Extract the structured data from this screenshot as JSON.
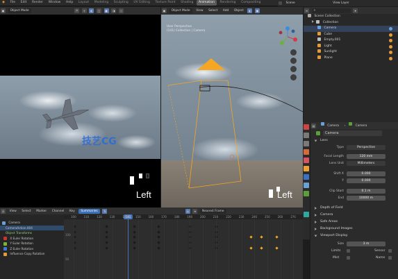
{
  "menu": {
    "items": [
      "File",
      "Edit",
      "Render",
      "Window",
      "Help"
    ],
    "workspaces": [
      "Layout",
      "Modeling",
      "Sculpting",
      "UV Editing",
      "Texture Paint",
      "Shading",
      "Animation",
      "Rendering",
      "Compositing"
    ],
    "active_workspace": "Animation",
    "scene": "Scene",
    "view_layer": "View Layer"
  },
  "viewport_header": {
    "left_mode": "Object Mode",
    "orientation": "Global",
    "default": "Default",
    "drag": "Drag",
    "select_box": "Select Box",
    "local": "Local",
    "viewport_menus": [
      "View",
      "Select",
      "Add",
      "Object"
    ],
    "object_mode_right": "Object Mode",
    "cursor": "Cursor",
    "options": "Options"
  },
  "camera_view": {
    "label_line1": "User Perspective",
    "label_line2": "(141) Collection | Camera",
    "left_text_a": "Left",
    "left_text_b": "Left",
    "watermark": "技艺CG"
  },
  "outliner": {
    "title": "Scene Collection",
    "rows": [
      {
        "name": "Collection",
        "indent": 0,
        "color": "#bdbdbd",
        "selected": false
      },
      {
        "name": "Camera",
        "indent": 1,
        "color": "#6aa0d8",
        "selected": true
      },
      {
        "name": "Cube",
        "indent": 1,
        "color": "#e59a3a",
        "selected": false
      },
      {
        "name": "Empty.001",
        "indent": 1,
        "color": "#bdbdbd",
        "selected": false
      },
      {
        "name": "Light",
        "indent": 1,
        "color": "#e59a3a",
        "selected": false
      },
      {
        "name": "Sunlight",
        "indent": 1,
        "color": "#e59a3a",
        "selected": false
      },
      {
        "name": "Plane",
        "indent": 1,
        "color": "#e59a3a",
        "selected": false
      }
    ]
  },
  "properties": {
    "breadcrumb_obj": "Camera",
    "breadcrumb_data": "Camera",
    "datablock": "Camera",
    "lens_section": "Lens",
    "type_label": "Type",
    "type_value": "Perspective",
    "focal_label": "Focal Length",
    "focal_value": "120 mm",
    "lens_unit_label": "Lens Unit",
    "lens_unit_value": "Millimeters",
    "shift_x_label": "Shift X",
    "shift_x_value": "0.000",
    "shift_y_label": "Y",
    "shift_y_value": "0.000",
    "clip_start_label": "Clip Start",
    "clip_start_value": "0.1 m",
    "clip_end_label": "End",
    "clip_end_value": "10000 m",
    "sections": [
      "Depth of Field",
      "Camera",
      "Safe Areas",
      "Background Images"
    ],
    "display_section": "Viewport Display",
    "size_label": "Size",
    "size_value": "3 m",
    "limits_label": "Limits",
    "mist_label": "Mist",
    "sensor_label": "Sensor",
    "name_label": "Name"
  },
  "timeline": {
    "menus": [
      "View",
      "Select",
      "Marker",
      "Channel",
      "Key"
    ],
    "mode": "Summaries",
    "nearest_frame": "Nearest Frame",
    "frame_ticks": [
      "100",
      "110",
      "120",
      "130",
      "140",
      "150",
      "160",
      "170",
      "180",
      "190",
      "200",
      "210",
      "220",
      "230",
      "240",
      "250",
      "260",
      "270"
    ],
    "current_frame": "141",
    "channels": [
      "Camera",
      "CameraAction.004",
      "Object Transforms",
      "X Euler Rotation",
      "Y Euler Rotation",
      "Z Euler Rotation",
      "Influence Copy Rotation"
    ],
    "y_values": [
      "100",
      "50"
    ]
  },
  "colors": {
    "accent": "#4772b3",
    "orange": "#f5a623",
    "selected_row": "#33415a"
  }
}
